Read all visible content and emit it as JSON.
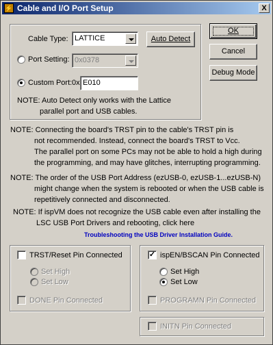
{
  "window": {
    "title": "Cable and I/O Port Setup",
    "close_label": "X"
  },
  "cable_type": {
    "label": "Cable Type:",
    "value": "LATTICE"
  },
  "auto_detect_label": "Auto Detect",
  "port_setting": {
    "label": "Port Setting:",
    "value": "0x0378",
    "selected": false
  },
  "custom_port": {
    "label": "Custom Port:",
    "prefix": "0x",
    "value": "E010",
    "selected": true
  },
  "auto_detect_note": {
    "line1": "NOTE: Auto Detect only works with the Lattice",
    "line2": "parallel port and USB cables."
  },
  "buttons": {
    "ok": "OK",
    "cancel": "Cancel",
    "debug": "Debug Mode"
  },
  "notes": {
    "trst": [
      "NOTE: Connecting the board's TRST pin to the cable's TRST pin is",
      "not recommended. Instead, connect the board's TRST to Vcc.",
      "The parallel port on some PCs may not be able to hold a high during",
      "the programming, and may have glitches, interrupting programming."
    ],
    "usb_order": [
      "NOTE: The order of the USB Port Address (ezUSB-0, ezUSB-1...ezUSB-N)",
      "might change when the system is rebooted or when the USB cable is",
      "repetitively connected and disconnected."
    ],
    "ispvm": [
      "NOTE: If ispVM does not recognize the USB cable even after installing the",
      "LSC USB Port Drivers and rebooting, click here"
    ],
    "troubleshoot_link": "Troubleshooting the USB Driver Installation Guide."
  },
  "trst_group": {
    "checkbox_label": "TRST/Reset Pin Connected",
    "checked": false,
    "set_high": "Set High",
    "set_low": "Set Low",
    "done_label": "DONE Pin Connected"
  },
  "ispen_group": {
    "checkbox_label": "ispEN/BSCAN Pin Connected",
    "checked": true,
    "set_high": "Set High",
    "set_low": "Set Low",
    "selected": "Set Low",
    "programn_label": "PROGRAMN Pin Connected"
  },
  "initn_label": "INITN Pin Connected"
}
